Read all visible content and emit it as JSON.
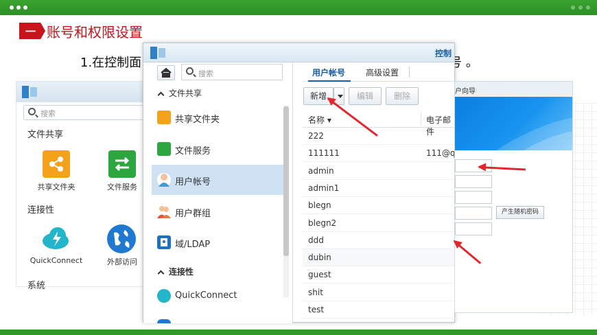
{
  "slide": {
    "badge": "一",
    "title": "账号和权限设置",
    "step_text": "1.在控制面",
    "step_tail": "号 。"
  },
  "back_window": {
    "search_placeholder": "搜索",
    "section_file": "文件共享",
    "tile_shared_folder": "共享文件夹",
    "tile_file_service": "文件服务",
    "section_connectivity": "连接性",
    "tile_quickconnect": "QuickConnect",
    "tile_external": "外部访问",
    "section_system": "系统"
  },
  "main_window": {
    "title": "控制",
    "search_placeholder": "搜索",
    "sidebar": {
      "section_file": "文件共享",
      "items": [
        {
          "label": "共享文件夹",
          "icon": "shared-folder-icon",
          "color": "#f4a21b"
        },
        {
          "label": "文件服务",
          "icon": "file-service-icon",
          "color": "#2ca63f"
        },
        {
          "label": "用户帐号",
          "icon": "user-icon",
          "color": "#3d9bd6"
        },
        {
          "label": "用户群组",
          "icon": "user-group-icon",
          "color": "#e0563a"
        },
        {
          "label": "域/LDAP",
          "icon": "ldap-icon",
          "color": "#1f6fbf"
        }
      ],
      "section_connectivity": "连接性",
      "quickconnect": "QuickConnect"
    },
    "tabs": {
      "users": "用户帐号",
      "advanced": "高级设置"
    },
    "toolbar": {
      "add": "新增",
      "edit": "编辑",
      "delete": "删除"
    },
    "columns": {
      "name": "名称",
      "email": "电子邮件"
    },
    "rows": [
      {
        "name": "222",
        "email": ""
      },
      {
        "name": "111111",
        "email": "111@q"
      },
      {
        "name": "admin",
        "email": ""
      },
      {
        "name": "admin1",
        "email": ""
      },
      {
        "name": "blegn",
        "email": ""
      },
      {
        "name": "blegn2",
        "email": ""
      },
      {
        "name": "ddd",
        "email": ""
      },
      {
        "name": "dubin",
        "email": ""
      },
      {
        "name": "guest",
        "email": ""
      },
      {
        "name": "shit",
        "email": ""
      },
      {
        "name": "test",
        "email": ""
      }
    ]
  },
  "wizard": {
    "title": "户向导",
    "random_password_button": "产生随机密码"
  },
  "colors": {
    "accent_green": "#2f9a28",
    "title_red": "#c8141b",
    "arrow_red": "#e3262d",
    "selection_blue": "#cfe2f4"
  }
}
